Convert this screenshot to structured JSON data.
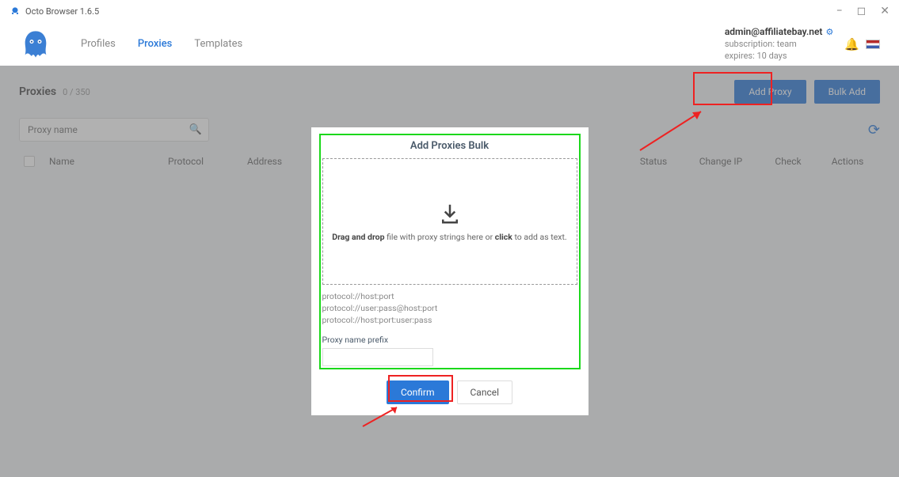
{
  "titlebar": {
    "title": "Octo Browser 1.6.5"
  },
  "nav": {
    "profiles": "Profiles",
    "proxies": "Proxies",
    "templates": "Templates"
  },
  "user": {
    "email": "admin@affiliatebay.net",
    "sub_label": "subscription: team",
    "expires_label": "expires: 10 days"
  },
  "page": {
    "title": "Proxies",
    "count": "0 / 350"
  },
  "actions": {
    "add_proxy": "Add Proxy",
    "bulk_add": "Bulk Add"
  },
  "search": {
    "placeholder": "Proxy name"
  },
  "columns": {
    "name": "Name",
    "protocol": "Protocol",
    "address": "Address",
    "status": "Status",
    "changeip": "Change IP",
    "check": "Check",
    "actions": "Actions"
  },
  "modal": {
    "title": "Add Proxies Bulk",
    "drop_bold1": "Drag and drop",
    "drop_mid": " file with proxy strings here or ",
    "drop_bold2": "click",
    "drop_end": " to add as text.",
    "hint1": "protocol://host:port",
    "hint2": "protocol://user:pass@host:port",
    "hint3": "protocol://host:port:user:pass",
    "prefix_label": "Proxy name prefix",
    "confirm": "Confirm",
    "cancel": "Cancel"
  }
}
